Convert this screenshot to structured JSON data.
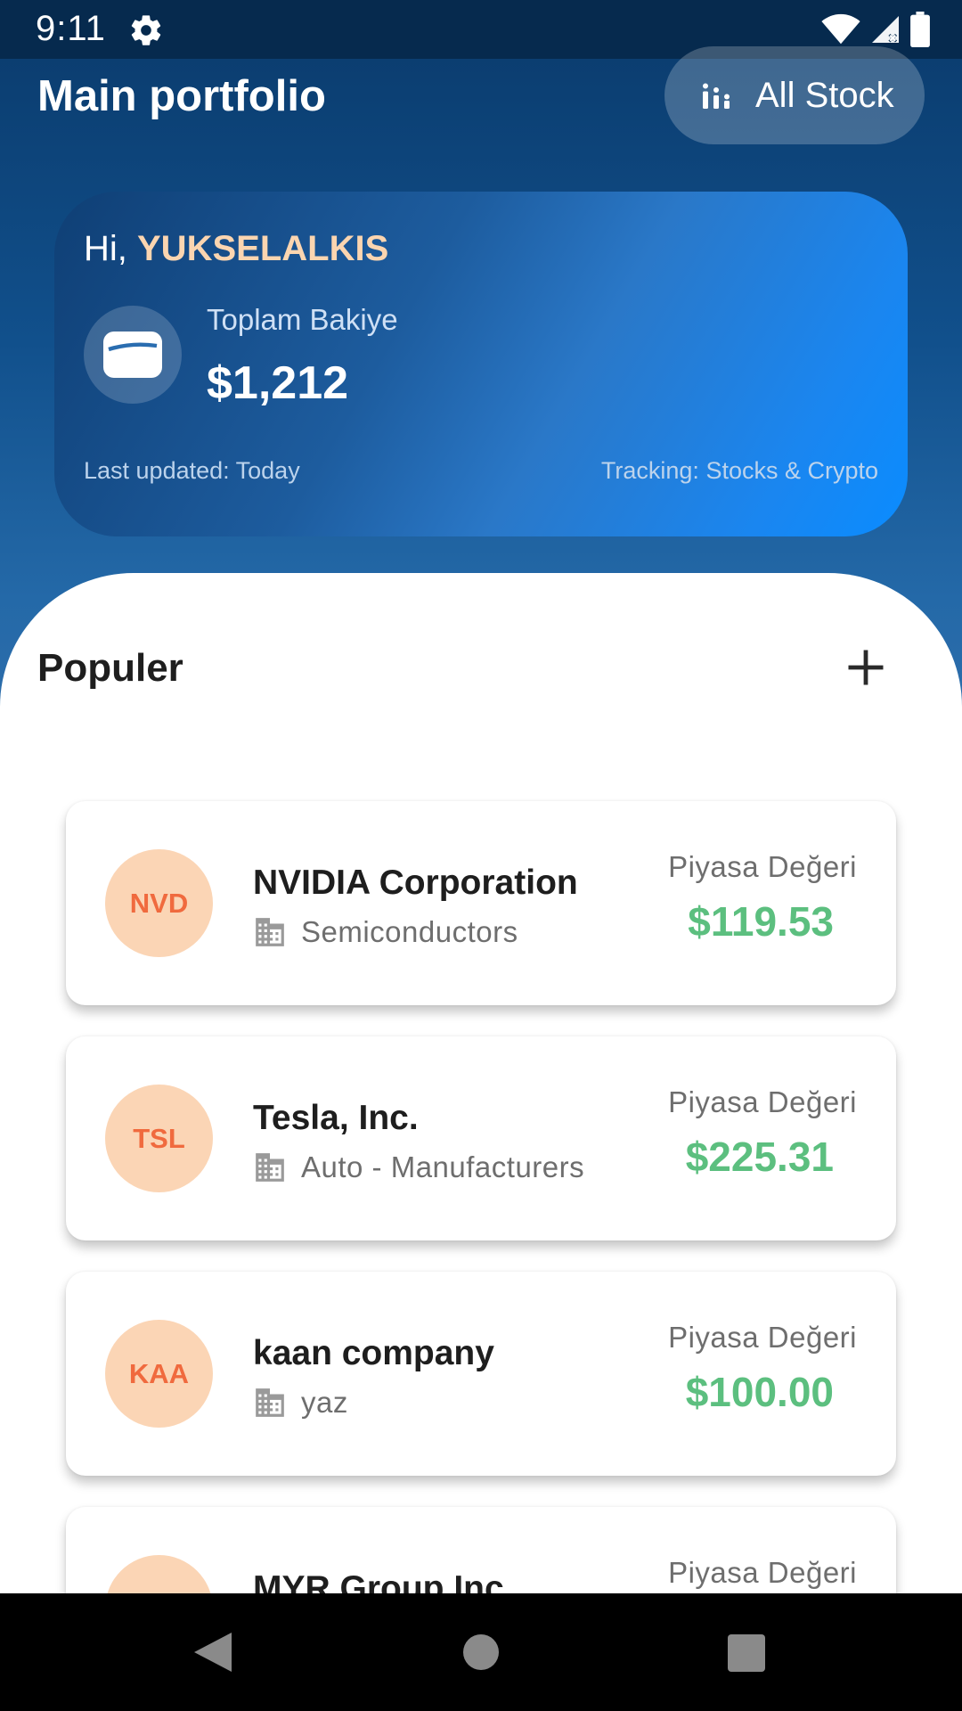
{
  "status_bar": {
    "time": "9:11",
    "icons": [
      "gear-icon",
      "wifi-icon",
      "signal-icon",
      "battery-icon"
    ]
  },
  "header": {
    "title": "Main portfolio",
    "all_stock_label": "All Stock"
  },
  "balance_card": {
    "greeting_prefix": "Hi, ",
    "username": "YUKSELALKIS",
    "balance_label": "Toplam Bakiye",
    "balance_value": "$1,212",
    "last_updated": "Last updated: Today",
    "tracking": "Tracking: Stocks & Crypto"
  },
  "popular": {
    "title": "Populer",
    "stocks": [
      {
        "abbr": "NVD",
        "name": "NVIDIA Corporation",
        "sector": "Semiconductors",
        "market_label": "Piyasa Değeri",
        "market_value": "$119.53"
      },
      {
        "abbr": "TSL",
        "name": "Tesla, Inc.",
        "sector": "Auto - Manufacturers",
        "market_label": "Piyasa Değeri",
        "market_value": "$225.31"
      },
      {
        "abbr": "KAA",
        "name": "kaan company",
        "sector": "yaz",
        "market_label": "Piyasa Değeri",
        "market_value": "$100.00"
      },
      {
        "abbr": "",
        "name": "MYR Group Inc.",
        "sector": "",
        "market_label": "Piyasa Değeri",
        "market_value": ""
      }
    ]
  },
  "colors": {
    "accent_gain": "#5cbf7f",
    "avatar_bg": "#fbd5b5",
    "avatar_text": "#f06a3e",
    "username": "#fbd5b0"
  }
}
